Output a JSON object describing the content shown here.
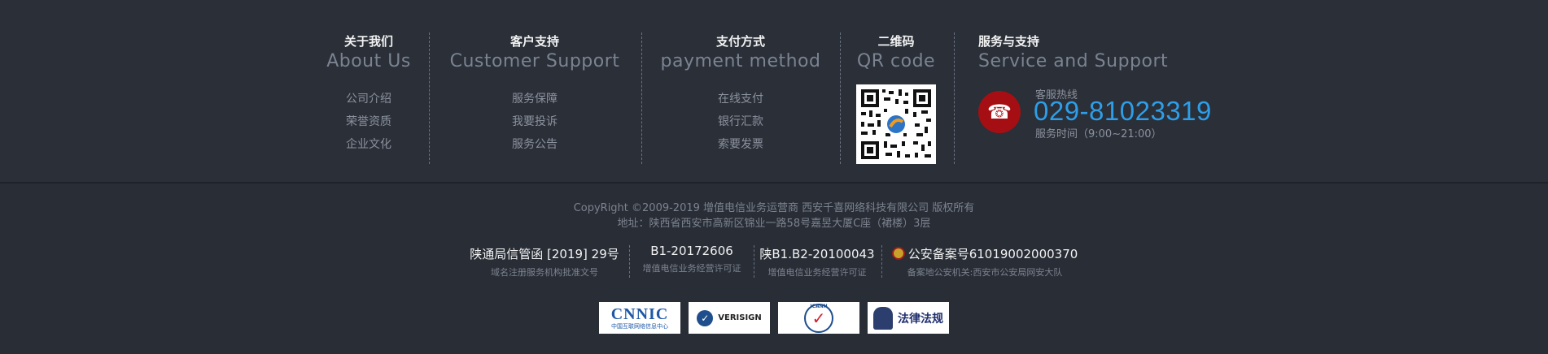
{
  "columns": [
    {
      "title": "关于我们",
      "en": "About Us",
      "items": [
        "公司介绍",
        "荣誉资质",
        "企业文化"
      ]
    },
    {
      "title": "客户支持",
      "en": "Customer Support",
      "items": [
        "服务保障",
        "我要投诉",
        "服务公告"
      ]
    },
    {
      "title": "支付方式",
      "en": "payment method",
      "items": [
        "在线支付",
        "银行汇款",
        "索要发票"
      ]
    },
    {
      "title": "二维码",
      "en": "QR code"
    }
  ],
  "service": {
    "title": "服务与支持",
    "en": "Service and Support",
    "phone_icon": "☎",
    "hotline_label": "客服热线",
    "hotline_number": "029-81023319",
    "hours": "服务时间（9:00~21:00）"
  },
  "footer": {
    "copyright": "CopyRight ©2009-2019 增值电信业务运营商 西安千喜网络科技有限公司 版权所有",
    "address": "地址：陕西省西安市高新区锦业一路58号嘉昱大厦C座（裙楼）3层",
    "licenses": [
      {
        "title": "陕通局信管函 [2019] 29号",
        "sub": "域名注册服务机构批准文号"
      },
      {
        "title": "B1-20172606",
        "sub": "增值电信业务经营许可证"
      },
      {
        "title": "陕B1.B2-20100043",
        "sub": "增值电信业务经营许可证"
      },
      {
        "title": "公安备案号61019002000370",
        "sub": "备案地公安机关:西安市公安局网安大队"
      }
    ],
    "badges": {
      "cnnic": "CNNIC",
      "cnnic_sub": "中国互联网络信息中心",
      "verisign": "VERISIGN",
      "icann": "ICANN",
      "law": "法律法规"
    }
  },
  "colors": {
    "background": "#2a2f38",
    "accent": "#2e9ee8",
    "phone_bg": "#a50f14"
  }
}
